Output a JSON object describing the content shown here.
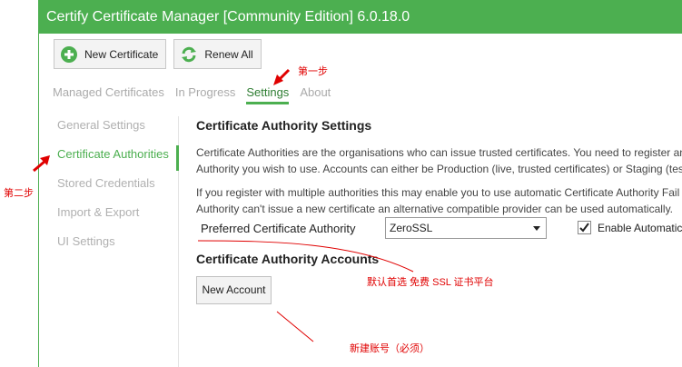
{
  "window": {
    "title": "Certify Certificate Manager [Community Edition] 6.0.18.0"
  },
  "toolbar": {
    "new_certificate": "New Certificate",
    "renew_all": "Renew All"
  },
  "tabs": [
    {
      "label": "Managed Certificates"
    },
    {
      "label": "In Progress"
    },
    {
      "label": "Settings"
    },
    {
      "label": "About"
    }
  ],
  "sidebar": {
    "items": [
      {
        "label": "General Settings"
      },
      {
        "label": "Certificate Authorities"
      },
      {
        "label": "Stored Credentials"
      },
      {
        "label": "Import & Export"
      },
      {
        "label": "UI Settings"
      }
    ]
  },
  "ca": {
    "title": "Certificate Authority Settings",
    "desc1": "Certificate Authorities are the organisations who can issue trusted certificates. You need to register an",
    "desc2": "Authority you wish to use. Accounts can either be Production (live, trusted certificates) or Staging (tes",
    "desc3": "If you register with multiple authorities this may enable you to use automatic Certificate Authority Fail",
    "desc4": "Authority can't issue a new certificate an alternative compatible provider can be used automatically.",
    "preferred_label": "Preferred Certificate Authority",
    "preferred_value": "ZeroSSL",
    "enable_automatic": "Enable Automatic",
    "accounts_title": "Certificate Authority Accounts",
    "new_account": "New Account"
  },
  "annotations": {
    "step1": "第一步",
    "step2": "第二步",
    "default_note": "默认首选 免费 SSL 证书平台",
    "new_account_note": "新建账号（必须）"
  },
  "colors": {
    "accent": "#4caf50",
    "annotation": "#e00000"
  }
}
